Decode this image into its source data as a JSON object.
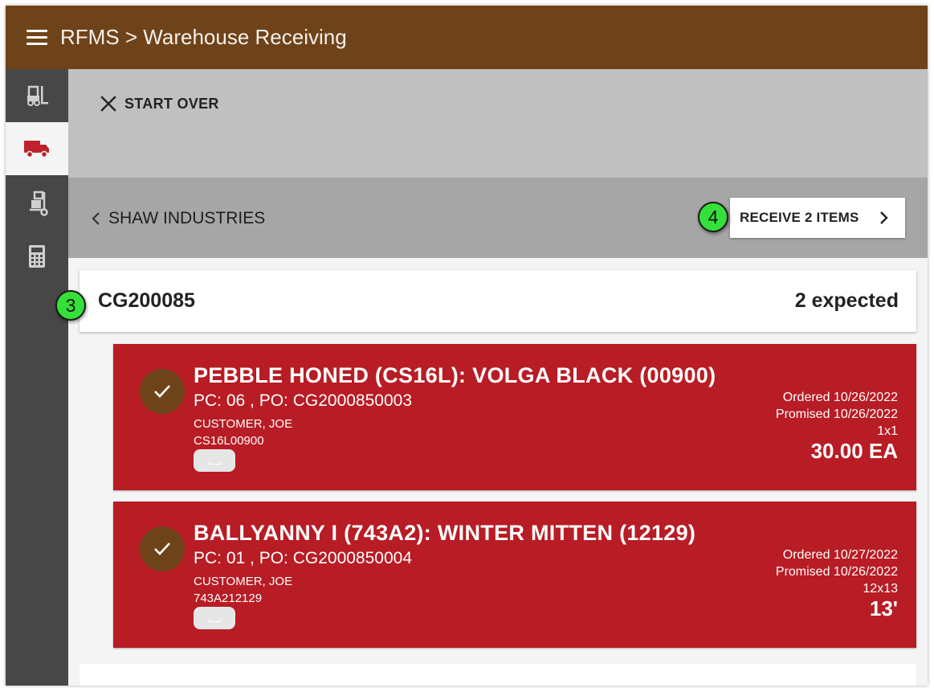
{
  "header": {
    "title": "RFMS > Warehouse Receiving"
  },
  "sidebar": {
    "items": [
      {
        "icon": "forklift-icon",
        "active": false
      },
      {
        "icon": "truck-icon",
        "active": true
      },
      {
        "icon": "hand-truck-icon",
        "active": false
      },
      {
        "icon": "calculator-icon",
        "active": false
      }
    ]
  },
  "toolbar": {
    "start_over_label": "START OVER"
  },
  "vendor": {
    "name": "SHAW INDUSTRIES",
    "receive_label": "RECEIVE 2 ITEMS"
  },
  "callouts": {
    "three": "3",
    "four": "4"
  },
  "po": {
    "number": "CG200085",
    "expected": "2 expected"
  },
  "items": [
    {
      "title": "PEBBLE HONED (CS16L): VOLGA BLACK (00900)",
      "pc_po": "PC: 06 , PO: CG2000850003",
      "customer": "CUSTOMER, JOE",
      "style_code": "CS16L00900",
      "ordered": "Ordered 10/26/2022",
      "promised": "Promised 10/26/2022",
      "size": "1x1",
      "quantity": "30.00 EA",
      "checked": true
    },
    {
      "title": "BALLYANNY I (743A2): WINTER MITTEN (12129)",
      "pc_po": "PC: 01 , PO: CG2000850004",
      "customer": "CUSTOMER, JOE",
      "style_code": "743A212129",
      "ordered": "Ordered 10/27/2022",
      "promised": "Promised 10/26/2022",
      "size": "12x13",
      "quantity": "13'",
      "checked": true
    }
  ],
  "colors": {
    "header_brown": "#6e431a",
    "sidebar_gray": "#474747",
    "item_red": "#b81c24",
    "accent_red": "#c0202a",
    "callout_green": "#36e03a"
  }
}
